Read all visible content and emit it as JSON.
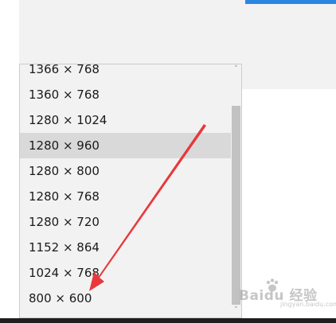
{
  "dropdown": {
    "options": [
      {
        "label": "1366 × 768"
      },
      {
        "label": "1360 × 768"
      },
      {
        "label": "1280 × 1024"
      },
      {
        "label": "1280 × 960",
        "selected": true
      },
      {
        "label": "1280 × 800"
      },
      {
        "label": "1280 × 768"
      },
      {
        "label": "1280 × 720"
      },
      {
        "label": "1152 × 864"
      },
      {
        "label": "1024 × 768"
      },
      {
        "label": "800 × 600"
      }
    ],
    "scroll_up_glyph": "˄",
    "scroll_down_glyph": "˅"
  },
  "watermark": {
    "text": "Baidu 经验",
    "subtext": "jingyan.baidu.com"
  },
  "colors": {
    "accent": "#2b86e0",
    "arrow": "#e8383b",
    "bottom_strip": "#1f1f1f"
  }
}
